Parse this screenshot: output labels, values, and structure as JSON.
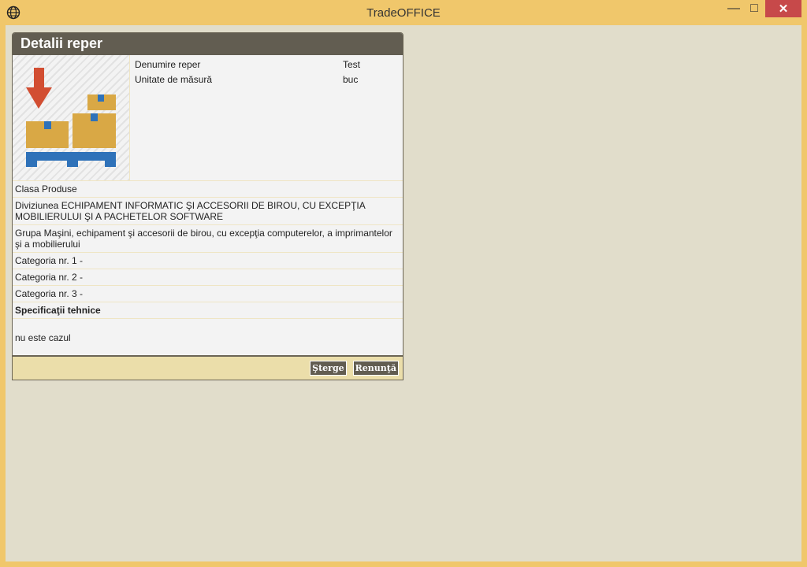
{
  "window": {
    "title": "TradeOFFICE",
    "minimize": "—",
    "maximize": "□",
    "close": "✕"
  },
  "panel": {
    "title": "Detalii reper",
    "properties": [
      {
        "label": "Denumire reper",
        "value": "Test"
      },
      {
        "label": "Unitate de măsură",
        "value": "buc"
      }
    ],
    "rows": [
      "Clasa Produse",
      "Diviziunea ECHIPAMENT INFORMATIC ŞI ACCESORII DE BIROU, CU EXCEPŢIA MOBILIERULUI ŞI A PACHETELOR SOFTWARE",
      "Grupa Maşini, echipament şi accesorii de birou, cu excepţia computerelor, a imprimantelor şi a mobilierului",
      "Categoria nr. 1 -",
      "Categoria nr. 2 -",
      "Categoria nr. 3 -"
    ],
    "spec_title": "Specificaţii tehnice",
    "spec_value": "nu este cazul",
    "buttons": {
      "delete": "Şterge",
      "cancel": "Renunţă"
    }
  },
  "colors": {
    "titlebar": "#f0c76b",
    "header": "#625d51",
    "close": "#c7494a"
  }
}
